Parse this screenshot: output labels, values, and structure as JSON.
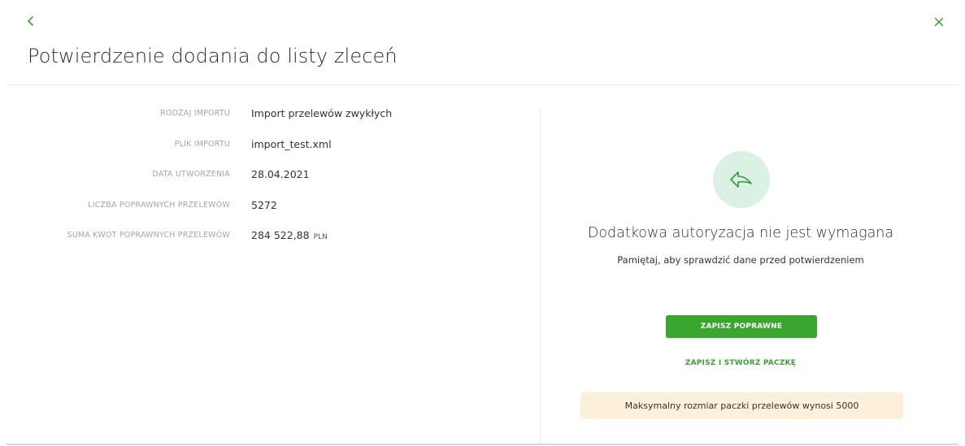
{
  "header": {
    "title": "Potwierdzenie dodania do listy zleceń",
    "back_icon": "chevron-left-icon",
    "close_icon": "close-icon"
  },
  "details": {
    "rows": [
      {
        "label": "RODZAJ IMPORTU",
        "value": "Import przelewów zwykłych",
        "currency": ""
      },
      {
        "label": "PLIK IMPORTU",
        "value": "import_test.xml",
        "currency": ""
      },
      {
        "label": "DATA UTWORZENIA",
        "value": "28.04.2021",
        "currency": ""
      },
      {
        "label": "LICZBA POPRAWNYCH PRZELEWÓW",
        "value": "5272",
        "currency": ""
      },
      {
        "label": "SUMA KWOT POPRAWNYCH PRZELEWÓW",
        "value": "284 522,88",
        "currency": "PLN"
      }
    ]
  },
  "status": {
    "icon": "reply-arrow-icon",
    "title": "Dodatkowa autoryzacja nie jest wymagana",
    "subtitle": "Pamiętaj, aby sprawdzić dane przed potwierdzeniem"
  },
  "actions": {
    "primary_label": "ZAPISZ POPRAWNE",
    "secondary_label": "ZAPISZ I STWÓRZ PACZKĘ"
  },
  "info": {
    "text": "Maksymalny rozmiar paczki przelewów wynosi 5000"
  },
  "colors": {
    "accent": "#3aa52f",
    "icon_bg": "#dbf1e3",
    "info_bg": "#fcf0db"
  }
}
